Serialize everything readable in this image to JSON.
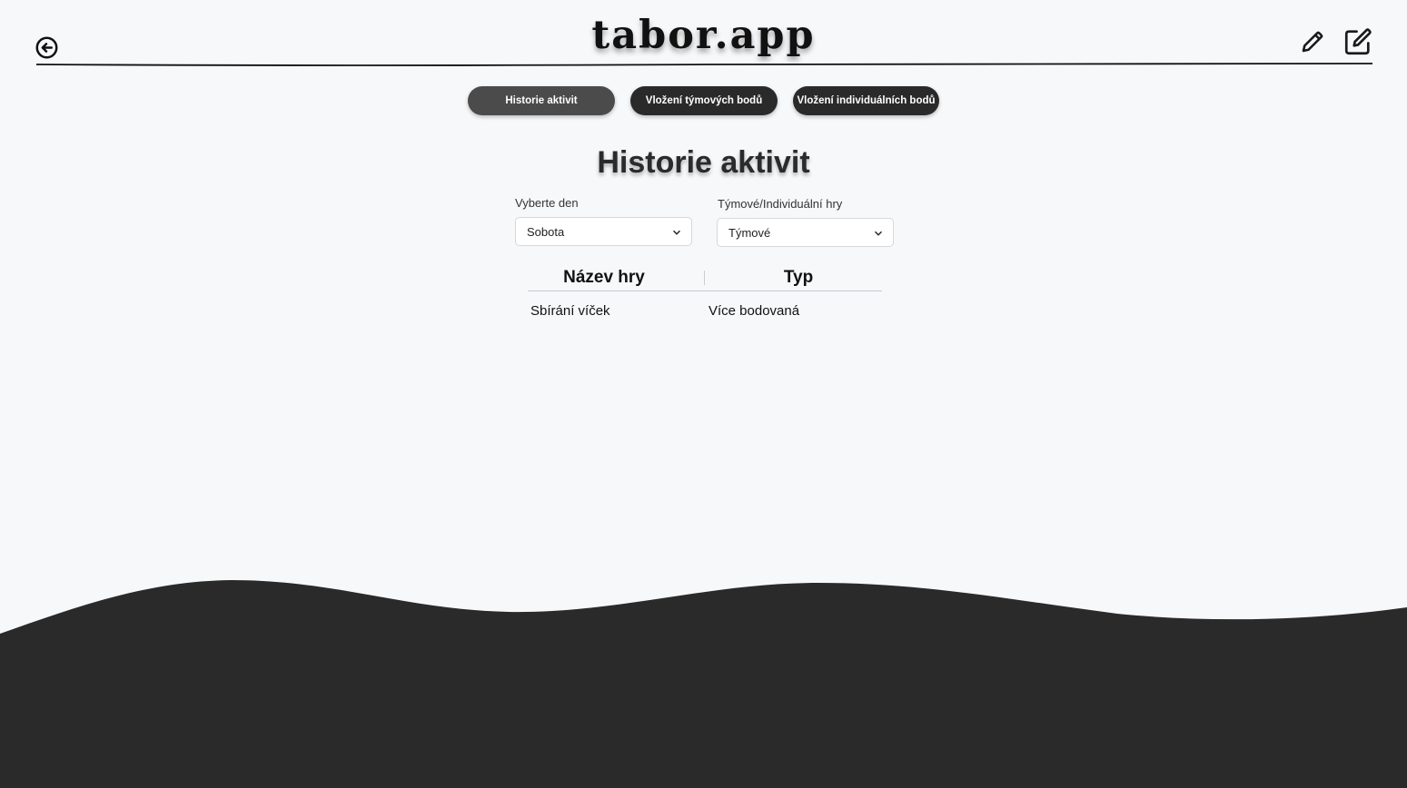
{
  "app": {
    "title": "tabor.app"
  },
  "header": {
    "back_icon": "arrow-left-circle-icon",
    "pencil_icon": "pencil-icon",
    "edit_icon": "edit-square-icon"
  },
  "tabs": [
    {
      "label": "Historie aktivit",
      "active": true
    },
    {
      "label": "Vložení týmových bodů",
      "active": false
    },
    {
      "label": "Vložení individuálních bodů",
      "active": false
    }
  ],
  "page": {
    "title": "Historie aktivit"
  },
  "filters": {
    "day": {
      "label": "Vyberte den",
      "value": "Sobota"
    },
    "mode": {
      "label": "Týmové/Individuální hry",
      "value": "Týmové"
    }
  },
  "table": {
    "columns": [
      "Název hry",
      "Typ"
    ],
    "rows": [
      [
        "Sbírání víček",
        "Více bodovaná"
      ]
    ]
  },
  "colors": {
    "background": "#f7f8fa",
    "dark": "#2a2a2a",
    "active_tab": "#4b4b4b"
  }
}
